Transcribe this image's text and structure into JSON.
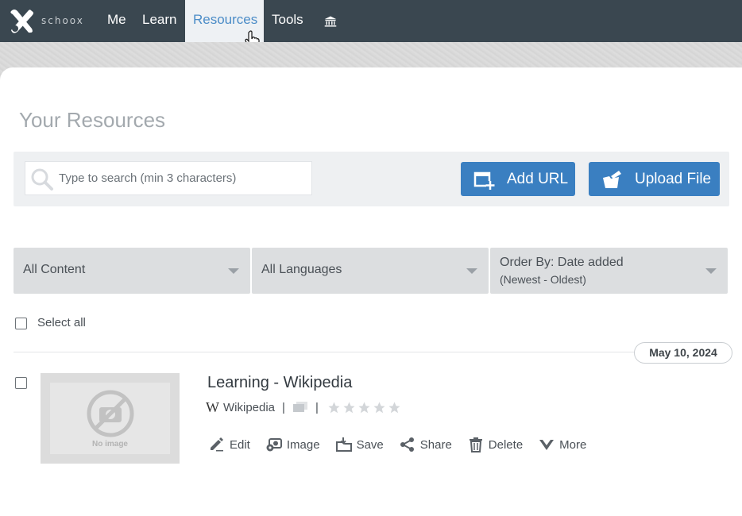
{
  "app": {
    "logo_text": "schoox"
  },
  "nav": {
    "me": "Me",
    "learn": "Learn",
    "resources": "Resources",
    "tools": "Tools",
    "bank_icon": "bank-icon"
  },
  "page": {
    "title": "Your Resources"
  },
  "search": {
    "placeholder": "Type to search (min 3 characters)",
    "value": ""
  },
  "buttons": {
    "add_url": "Add URL",
    "upload_file": "Upload File"
  },
  "filters": {
    "content": "All Content",
    "languages": "All Languages",
    "order_line1": "Order By: Date added",
    "order_line2": "(Newest - Oldest)"
  },
  "select_all": "Select all",
  "items": [
    {
      "date": "May 10, 2024",
      "thumb_text": "No image",
      "title": "Learning - Wikipedia",
      "source": "Wikipedia",
      "rating": 0,
      "actions": {
        "edit": "Edit",
        "image": "Image",
        "save": "Save",
        "share": "Share",
        "delete": "Delete",
        "more": "More"
      }
    }
  ],
  "colors": {
    "nav_bg": "#3a4750",
    "accent": "#3a7fc1",
    "active_nav_text": "#4b8cc7"
  }
}
